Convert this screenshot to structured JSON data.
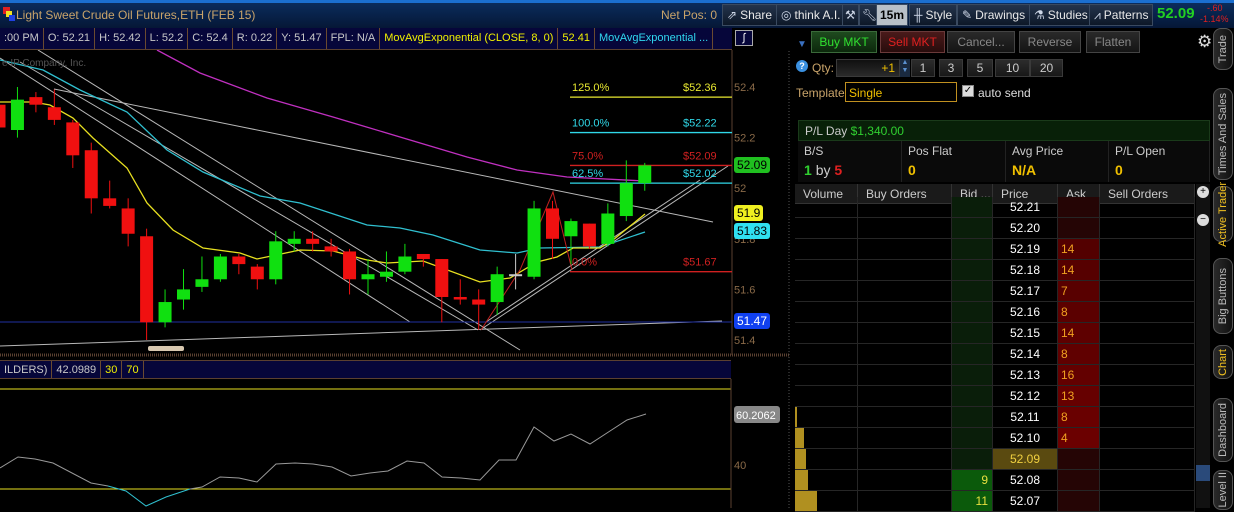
{
  "header": {
    "title": "Light Sweet Crude Oil Futures,ETH (FEB 15)",
    "net_pos": "Net Pos: 0",
    "toolbar": {
      "share": "Share",
      "think_ai": "think A.I.",
      "interval": "15m",
      "style": "Style",
      "drawings": "Drawings",
      "studies": "Studies",
      "patterns": "Patterns"
    },
    "last_price": "52.09",
    "change": "-.60",
    "change_pct": "-1.14%"
  },
  "infobar": {
    "time": ":00 PM",
    "open": "O: 52.21",
    "high": "H: 52.42",
    "low": "L: 52.2",
    "close": "C: 52.4",
    "range": "R: 0.22",
    "yclose": "Y: 51.47",
    "fpl": "FPL: N/A",
    "study1": "MovAvgExponential (CLOSE, 8, 0)",
    "study1_val": "52.41",
    "study2": "MovAvgExponential ..."
  },
  "chart": {
    "watermark": "e IP Company, Inc.",
    "price_axis": [
      "52.4",
      "52.2",
      "52",
      "51.8",
      "51.6",
      "51.4"
    ],
    "price_axis_values": [
      52.4,
      52.2,
      52.0,
      51.8,
      51.6,
      51.4
    ],
    "badges": {
      "last": "52.09",
      "ema_fast": "51.9",
      "ema_slow": "51.83",
      "hline": "51.47"
    },
    "fib": [
      {
        "pct": "125.0%",
        "price": "$52.36",
        "value": 52.36,
        "color": "#e8e830"
      },
      {
        "pct": "100.0%",
        "price": "$52.22",
        "value": 52.22,
        "color": "#30d8e8"
      },
      {
        "pct": "75.0%",
        "price": "$52.09",
        "value": 52.09,
        "color": "#d02020"
      },
      {
        "pct": "62.5%",
        "price": "$52.02",
        "value": 52.02,
        "color": "#30d8e8"
      },
      {
        "pct": "0.0%",
        "price": "$51.67",
        "value": 51.67,
        "color": "#d02020"
      }
    ],
    "candles": [
      [
        52.33,
        52.36,
        52.22,
        52.24
      ],
      [
        52.23,
        52.4,
        52.2,
        52.35
      ],
      [
        52.36,
        52.38,
        52.3,
        52.33
      ],
      [
        52.32,
        52.39,
        52.25,
        52.27
      ],
      [
        52.26,
        52.27,
        52.08,
        52.13
      ],
      [
        52.15,
        52.18,
        51.9,
        51.96
      ],
      [
        51.96,
        52.03,
        51.92,
        51.93
      ],
      [
        51.92,
        51.96,
        51.77,
        51.82
      ],
      [
        51.81,
        51.84,
        51.4,
        51.47
      ],
      [
        51.47,
        51.6,
        51.45,
        51.55
      ],
      [
        51.56,
        51.68,
        51.52,
        51.6
      ],
      [
        51.61,
        51.73,
        51.59,
        51.64
      ],
      [
        51.64,
        51.74,
        51.63,
        51.73
      ],
      [
        51.73,
        51.74,
        51.66,
        51.7
      ],
      [
        51.69,
        51.7,
        51.6,
        51.64
      ],
      [
        51.64,
        51.83,
        51.62,
        51.79
      ],
      [
        51.78,
        51.83,
        51.75,
        51.8
      ],
      [
        51.8,
        51.83,
        51.75,
        51.78
      ],
      [
        51.77,
        51.8,
        51.73,
        51.75
      ],
      [
        51.75,
        51.76,
        51.58,
        51.64
      ],
      [
        51.64,
        51.72,
        51.58,
        51.66
      ],
      [
        51.65,
        51.75,
        51.63,
        51.67
      ],
      [
        51.67,
        51.78,
        51.66,
        51.73
      ],
      [
        51.74,
        51.74,
        51.69,
        51.72
      ],
      [
        51.72,
        51.72,
        51.47,
        51.57
      ],
      [
        51.57,
        51.64,
        51.54,
        51.56
      ],
      [
        51.56,
        51.6,
        51.44,
        51.54
      ],
      [
        51.55,
        51.69,
        51.5,
        51.66
      ],
      [
        51.66,
        51.74,
        51.6,
        51.66
      ],
      [
        51.65,
        51.95,
        51.64,
        51.92
      ],
      [
        51.92,
        51.95,
        51.72,
        51.8
      ],
      [
        51.81,
        51.88,
        51.7,
        51.87
      ],
      [
        51.86,
        51.86,
        51.76,
        51.77
      ],
      [
        51.78,
        51.94,
        51.77,
        51.9
      ],
      [
        51.89,
        52.11,
        51.87,
        52.02
      ],
      [
        52.02,
        52.1,
        51.99,
        52.09
      ]
    ]
  },
  "rsi": {
    "label": "ILDERS)",
    "value": "42.0989",
    "oversold": "30",
    "overbought": "70",
    "axis_label": "40",
    "badge": "60.2062"
  },
  "order": {
    "buy": "Buy MKT",
    "sell": "Sell MKT",
    "cancel": "Cancel...",
    "reverse": "Reverse",
    "flatten": "Flatten",
    "qty_label": "Qty:",
    "qty": "+1",
    "qty_presets": [
      "1",
      "3",
      "5",
      "10",
      "20"
    ],
    "template_label": "Template:",
    "template": "Single",
    "auto_send": "auto send",
    "auto_send_checked": true
  },
  "pl": {
    "day_label": "P/L Day",
    "day_value": "$1,340.00",
    "bs_label": "B/S",
    "bs_buy": "1",
    "bs_by": "by",
    "bs_sell": "5",
    "pos_label": "Pos Flat",
    "pos_value": "0",
    "avg_label": "Avg Price",
    "avg_value": "N/A",
    "open_label": "P/L Open",
    "open_value": "0"
  },
  "ladder": {
    "headers": [
      "Volume",
      "Buy Orders",
      "Bid ...",
      "Price",
      "Ask ...",
      "Sell Orders"
    ],
    "rows": [
      {
        "price": "52.21",
        "ask": "",
        "bid": "",
        "vol": 0
      },
      {
        "price": "52.20",
        "ask": "",
        "bid": "",
        "vol": 0
      },
      {
        "price": "52.19",
        "ask": "14",
        "bid": "",
        "vol": 0
      },
      {
        "price": "52.18",
        "ask": "14",
        "bid": "",
        "vol": 0
      },
      {
        "price": "52.17",
        "ask": "7",
        "bid": "",
        "vol": 0
      },
      {
        "price": "52.16",
        "ask": "8",
        "bid": "",
        "vol": 0
      },
      {
        "price": "52.15",
        "ask": "14",
        "bid": "",
        "vol": 0
      },
      {
        "price": "52.14",
        "ask": "8",
        "bid": "",
        "vol": 0
      },
      {
        "price": "52.13",
        "ask": "16",
        "bid": "",
        "vol": 0
      },
      {
        "price": "52.12",
        "ask": "13",
        "bid": "",
        "vol": 0
      },
      {
        "price": "52.11",
        "ask": "8",
        "bid": "",
        "vol": 0.03
      },
      {
        "price": "52.10",
        "ask": "4",
        "bid": "",
        "vol": 0.14
      },
      {
        "price": "52.09",
        "ask": "",
        "bid": "",
        "vol": 0.17,
        "last": true
      },
      {
        "price": "52.08",
        "ask": "",
        "bid": "9",
        "vol": 0.2
      },
      {
        "price": "52.07",
        "ask": "",
        "bid": "11",
        "vol": 0.35
      }
    ]
  },
  "side_tabs": [
    "Trade",
    "Times And Sales",
    "Active Trader",
    "Big Buttons",
    "Chart",
    "Dashboard",
    "Level II"
  ]
}
